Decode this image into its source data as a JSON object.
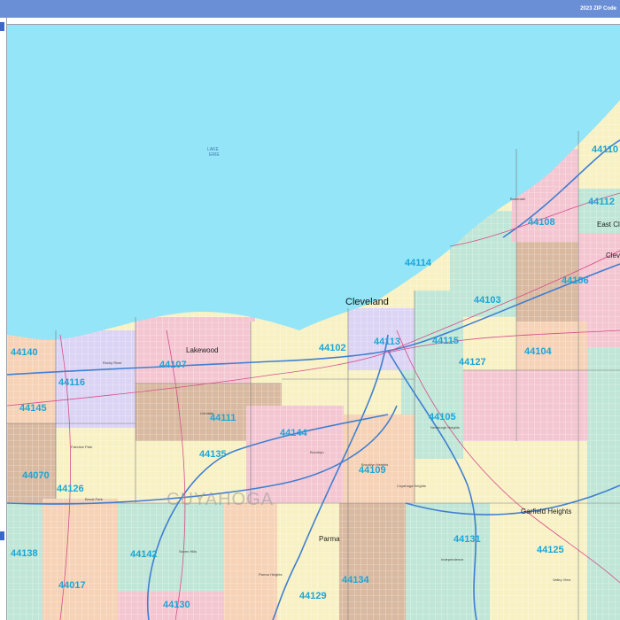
{
  "header": {
    "title": "2023 ZIP Code"
  },
  "map": {
    "lake_label": [
      "LAKE",
      "ERIE"
    ],
    "county_label": "CUYAHOGA",
    "cities": {
      "cleveland": "Cleveland",
      "lakewood": "Lakewood",
      "parma": "Parma",
      "garfield_heights": "Garfield Heights",
      "east_cleveland": "East Clev",
      "cleve_partial": "Cleve"
    },
    "minor_places": {
      "rocky_river": "Rocky River",
      "fairview_park": "Fairview Park",
      "brooklyn": "Brooklyn",
      "linndale": "Linndale",
      "brook_park": "Brook Park",
      "parma_heights": "Parma Heights",
      "seven_hills": "Seven Hills",
      "newburgh_heights": "Newburgh Heights",
      "cuyahoga_heights": "Cuyahoga Heights",
      "independence": "Independence",
      "valley_view": "Valley View",
      "bratenahl": "Bratenahl",
      "brooklyn_heights": "Brooklyn Heights"
    },
    "zips": {
      "z44110": "44110",
      "z44112": "44112",
      "z44108": "44108",
      "z44114": "44114",
      "z44106": "44106",
      "z44103": "44103",
      "z44140": "44140",
      "z44107": "44107",
      "z44102": "44102",
      "z44113": "44113",
      "z44115": "44115",
      "z44127": "44127",
      "z44104": "44104",
      "z44116": "44116",
      "z44145": "44145",
      "z44111": "44111",
      "z44105": "44105",
      "z44144": "44144",
      "z44135": "44135",
      "z44070": "44070",
      "z44109": "44109",
      "z44126": "44126",
      "z44138": "44138",
      "z44142": "44142",
      "z44131": "44131",
      "z44125": "44125",
      "z44017": "44017",
      "z44129": "44129",
      "z44134": "44134",
      "z44130": "44130"
    },
    "colors": {
      "water": "#93e5f7",
      "tan": "#d9b9a0",
      "pink": "#f4c6d2",
      "yellow": "#f8f1c4",
      "green": "#bfe6d6",
      "lavender": "#dcd4f4",
      "peach": "#f6d2b6",
      "zip_label": "#1aa6d8",
      "highway": "#3f7fd1",
      "road": "#d64d8a"
    }
  }
}
